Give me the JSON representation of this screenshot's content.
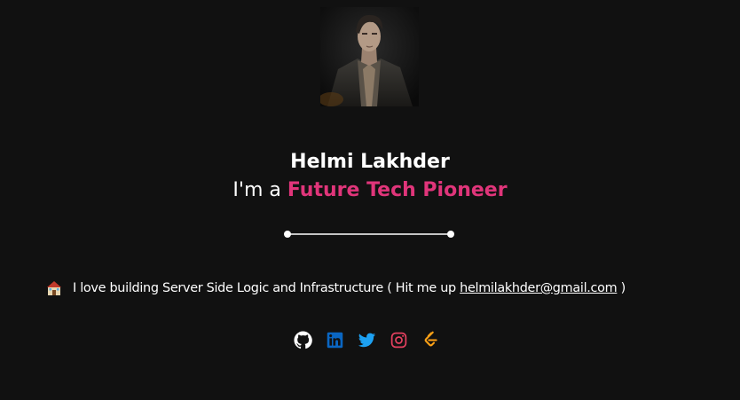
{
  "profile": {
    "name": "Helmi Lakhder",
    "tagline_prefix": "I'm a",
    "tagline_highlight": "Future Tech Pioneer",
    "accent_color": "#e0357a"
  },
  "bio": {
    "emoji": "house-emoji",
    "text": "I love building Server Side Logic and Infrastructure ( Hit me up",
    "email": "helmilakhder@gmail.com",
    "suffix": ")"
  },
  "socials": [
    {
      "name": "GitHub",
      "icon": "github-icon",
      "color": "#ffffff"
    },
    {
      "name": "LinkedIn",
      "icon": "linkedin-icon",
      "color": "#0a66c2"
    },
    {
      "name": "Twitter",
      "icon": "twitter-icon",
      "color": "#1da1f2"
    },
    {
      "name": "Instagram",
      "icon": "instagram-icon",
      "color": "#e4405f"
    },
    {
      "name": "LeetCode",
      "icon": "leetcode-icon",
      "color": "#ffa116"
    }
  ],
  "colors": {
    "background": "#111111",
    "text": "#ffffff"
  }
}
